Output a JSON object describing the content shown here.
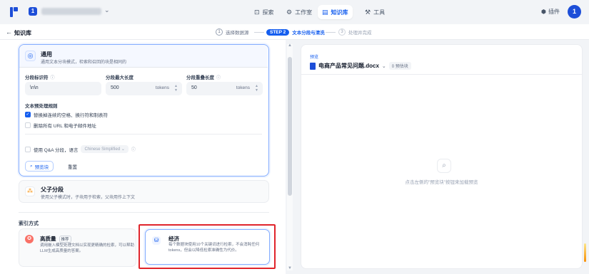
{
  "topbar": {
    "workspace_initial": "1",
    "nav": [
      {
        "label": "探索",
        "icon": "explore-icon"
      },
      {
        "label": "工作室",
        "icon": "studio-icon"
      },
      {
        "label": "知识库",
        "icon": "knowledge-icon",
        "active": true
      },
      {
        "label": "工具",
        "icon": "tools-icon"
      }
    ],
    "plugin_label": "插件",
    "avatar_initial": "1"
  },
  "subheader": {
    "title": "知识库",
    "steps": [
      {
        "num": "1",
        "label": "选择数据源"
      },
      {
        "num": "STEP 2",
        "label": "文本分段与清洗",
        "active": true
      },
      {
        "num": "3",
        "label": "处理并完成"
      }
    ]
  },
  "general": {
    "title": "通用",
    "desc": "通用文本分块模式，检索和召回的块是相同的",
    "separator_label": "分段标识符",
    "separator_value": "\\n\\n",
    "max_len_label": "分段最大长度",
    "max_len_value": "500",
    "overlap_label": "分段重叠长度",
    "overlap_value": "50",
    "unit": "tokens",
    "rules_title": "文本预处理规则",
    "rule1": "替换掉连续的空格、换行符和制表符",
    "rule2": "删除所有 URL 和电子邮件地址",
    "qa_label": "使用 Q&A 分段，语言",
    "qa_lang": "Chinese Simplified",
    "preview_btn": "预览块",
    "reset_btn": "重置"
  },
  "parent_child": {
    "title": "父子分段",
    "desc": "使用父子模式时，子块用于检索，父块用作上下文"
  },
  "index": {
    "title": "索引方式",
    "high_quality": {
      "title": "高质量",
      "badge": "推荐",
      "desc": "调用嵌入模型处理文档以实现更精确的检索，可以帮助LLM生成高质量的答案。"
    },
    "economy": {
      "title": "经济",
      "desc": "每个数据块使用10个关键词进行检索，不会消耗任何tokens，但会以降低检索准确性为代价。"
    }
  },
  "preview": {
    "label": "预览",
    "file_name": "电商产品常见问题.docx",
    "count": "0 预估块",
    "empty": "点击左侧的\"预览块\"按钮来加载预览"
  },
  "colors": {
    "accent": "#155eef",
    "highlight_box": "#e0242b"
  }
}
